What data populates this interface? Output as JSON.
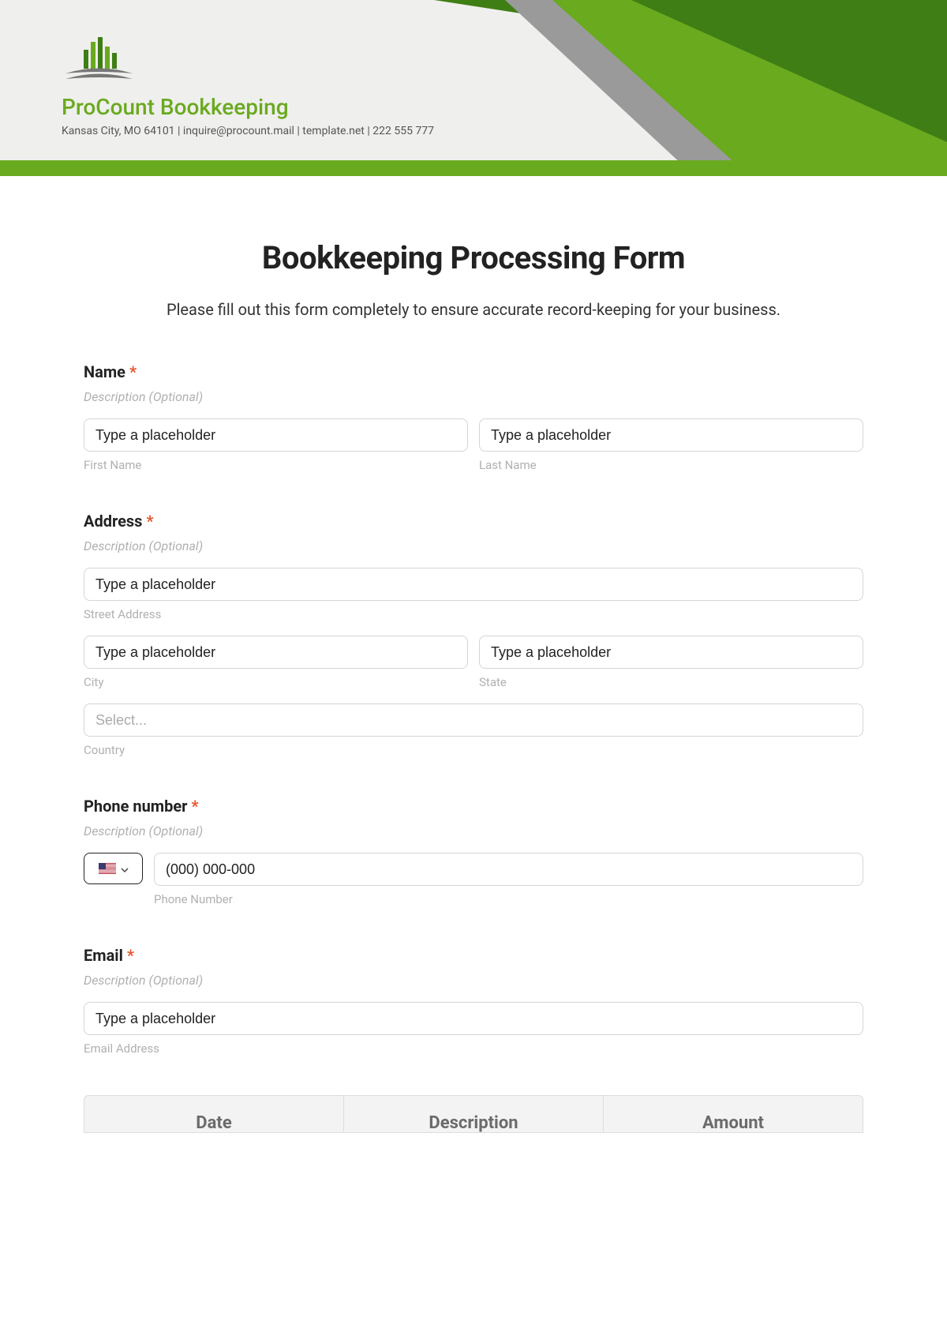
{
  "header": {
    "company_name": "ProCount Bookkeeping",
    "meta": "Kansas City, MO 64101 | inquire@procount.mail | template.net | 222 555 777",
    "colors": {
      "brand_green": "#6aaa1f",
      "dark_green": "#3f7e15",
      "gray": "#9a9a9a"
    }
  },
  "form": {
    "title": "Bookkeeping Processing Form",
    "intro": "Please fill out this form completely to ensure accurate record-keeping for your business.",
    "name": {
      "label": "Name",
      "required": "*",
      "desc": "Description (Optional)",
      "first_placeholder": "Type a placeholder",
      "first_sub": "First Name",
      "last_placeholder": "Type a placeholder",
      "last_sub": "Last Name"
    },
    "address": {
      "label": "Address",
      "required": "*",
      "desc": "Description (Optional)",
      "street_placeholder": "Type a placeholder",
      "street_sub": "Street Address",
      "city_placeholder": "Type a placeholder",
      "city_sub": "City",
      "state_placeholder": "Type a placeholder",
      "state_sub": "State",
      "country_placeholder": "Select...",
      "country_sub": "Country"
    },
    "phone": {
      "label": "Phone number",
      "required": "*",
      "desc": "Description (Optional)",
      "placeholder": "(000) 000-000",
      "sub": "Phone Number"
    },
    "email": {
      "label": "Email",
      "required": "*",
      "desc": "Description (Optional)",
      "placeholder": "Type a placeholder",
      "sub": "Email Address"
    },
    "table": {
      "headers": [
        "Date",
        "Description",
        "Amount"
      ]
    }
  }
}
